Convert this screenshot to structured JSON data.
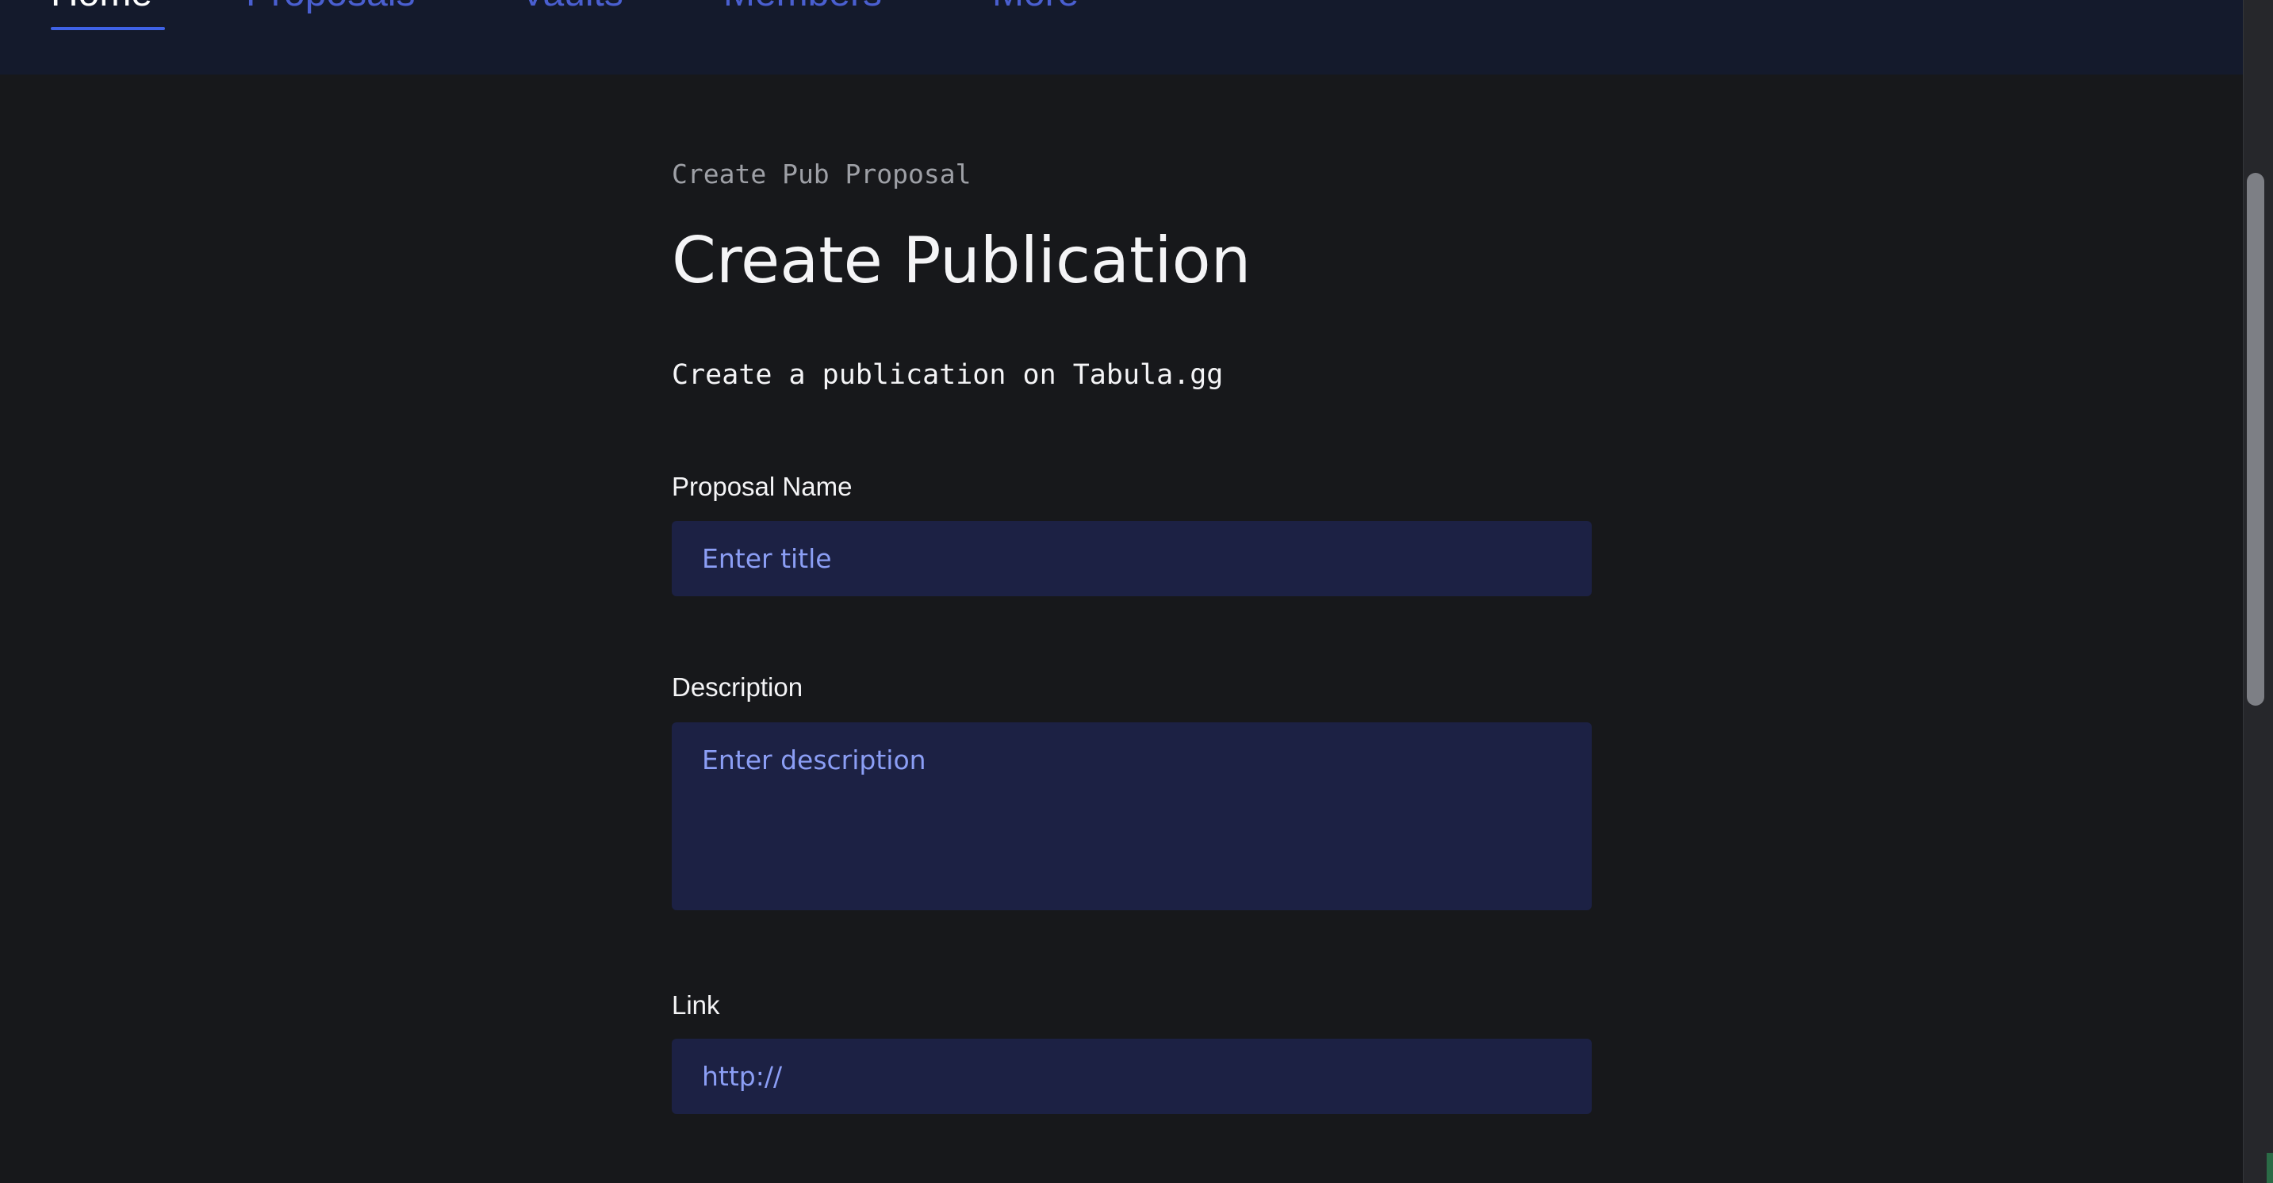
{
  "nav": {
    "tabs": [
      {
        "label": "Home",
        "active": true
      },
      {
        "label": "Proposals",
        "active": false
      },
      {
        "label": "Vaults",
        "active": false
      },
      {
        "label": "Members",
        "active": false
      },
      {
        "label": "More",
        "active": false
      }
    ]
  },
  "page": {
    "eyebrow": "Create Pub Proposal",
    "title": "Create Publication",
    "subtitle": "Create a publication on Tabula.gg"
  },
  "form": {
    "proposal_name": {
      "label": "Proposal Name",
      "placeholder": "Enter title",
      "value": ""
    },
    "description": {
      "label": "Description",
      "placeholder": "Enter description",
      "value": ""
    },
    "link": {
      "label": "Link",
      "placeholder": "http://",
      "value": ""
    }
  },
  "colors": {
    "background": "#17181b",
    "nav_background": "#141a2c",
    "accent": "#3f62e6",
    "input_background": "#1c2144",
    "placeholder": "#8b9ef5"
  }
}
